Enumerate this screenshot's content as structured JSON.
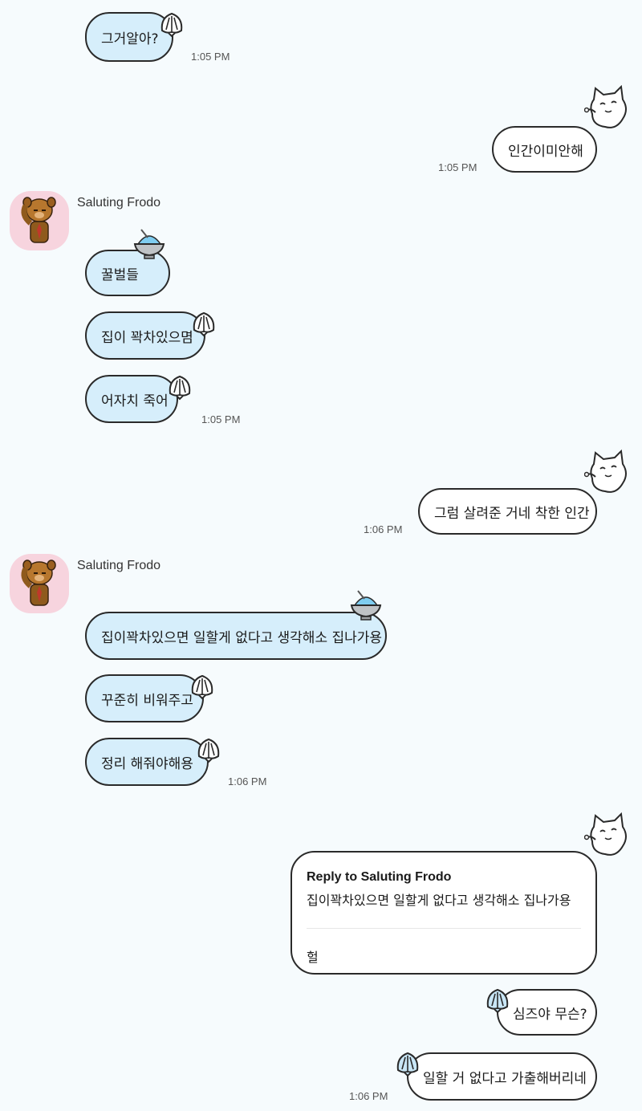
{
  "colors": {
    "background": "#f6fbfd",
    "incoming_bubble": "#d6eefb",
    "outgoing_bubble": "#ffffff",
    "border": "#2a2a2a",
    "avatar_bg": "#f7d4de"
  },
  "icons": [
    "shell-icon",
    "shaved-ice-icon",
    "white-cat-sticker-icon",
    "bear-avatar-icon"
  ],
  "messages": {
    "m1": {
      "text": "그거알아?",
      "time": "1:05 PM"
    },
    "m2": {
      "text": "인간이미안해",
      "time": "1:05 PM"
    },
    "group1": {
      "sender": "Saluting Frodo",
      "m3": {
        "text": "꿀벌들"
      },
      "m4": {
        "text": "집이 꽉차있으몀"
      },
      "m5": {
        "text": "어자치 죽어",
        "time": "1:05 PM"
      }
    },
    "m6": {
      "text": "그럼 살려준 거네 착한 인간",
      "time": "1:06 PM"
    },
    "group2": {
      "sender": "Saluting Frodo",
      "m7": {
        "text": "집이꽉차있으면 일할게 없다고 생각해소 집나가용"
      },
      "m8": {
        "text": "꾸준히 비워주고"
      },
      "m9": {
        "text": "정리 해줘야해용",
        "time": "1:06 PM"
      }
    },
    "reply": {
      "title": "Reply to Saluting Frodo",
      "quote": "집이꽉차있으면 일할게 없다고 생각해소 집나가용",
      "text": "헐"
    },
    "m10": {
      "text": "심즈야 무슨?"
    },
    "m11": {
      "text": "일할 거 없다고 가출해버리네",
      "time": "1:06 PM"
    }
  }
}
